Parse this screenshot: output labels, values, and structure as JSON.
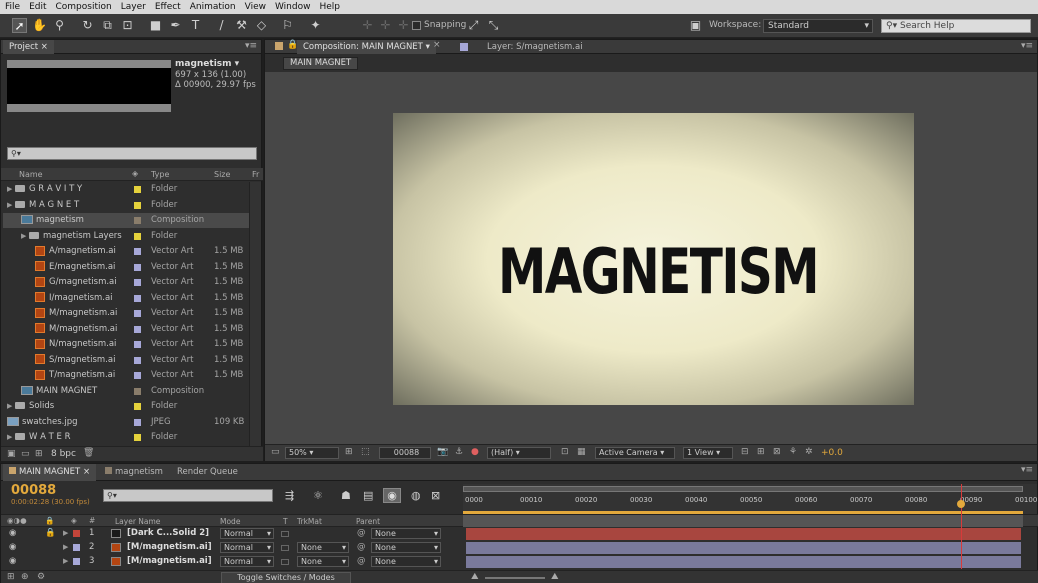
{
  "menu": [
    "File",
    "Edit",
    "Composition",
    "Layer",
    "Effect",
    "Animation",
    "View",
    "Window",
    "Help"
  ],
  "toolbar": {
    "snapping_label": "Snapping",
    "workspace_label": "Workspace:",
    "workspace_value": "Standard",
    "search_placeholder": "Search Help"
  },
  "project": {
    "tab_label": "Project",
    "preview_name": "magnetism ▾",
    "preview_dims": "697 x 136 (1.00)",
    "preview_info": "Δ 00900, 29.97 fps",
    "search_icon": "⚲▾",
    "columns": {
      "name": "Name",
      "type": "Type",
      "size": "Size",
      "fr": "Fr"
    },
    "items": [
      {
        "name": "G R A V I T Y",
        "type": "Folder",
        "size": "",
        "label_color": "#e5d23c",
        "kind": "folder",
        "indent": 0
      },
      {
        "name": "M A G N E T",
        "type": "Folder",
        "size": "",
        "label_color": "#e5d23c",
        "kind": "folder",
        "indent": 0
      },
      {
        "name": "magnetism",
        "type": "Composition",
        "size": "",
        "label_color": "#8a7d6b",
        "kind": "comp",
        "indent": 1
      },
      {
        "name": "magnetism Layers",
        "type": "Folder",
        "size": "",
        "label_color": "#e5d23c",
        "kind": "folder",
        "indent": 1
      },
      {
        "name": "A/magnetism.ai",
        "type": "Vector Art",
        "size": "1.5 MB",
        "label_color": "#a7a8d8",
        "kind": "ai",
        "indent": 2
      },
      {
        "name": "E/magnetism.ai",
        "type": "Vector Art",
        "size": "1.5 MB",
        "label_color": "#a7a8d8",
        "kind": "ai",
        "indent": 2
      },
      {
        "name": "G/magnetism.ai",
        "type": "Vector Art",
        "size": "1.5 MB",
        "label_color": "#a7a8d8",
        "kind": "ai",
        "indent": 2
      },
      {
        "name": "I/magnetism.ai",
        "type": "Vector Art",
        "size": "1.5 MB",
        "label_color": "#a7a8d8",
        "kind": "ai",
        "indent": 2
      },
      {
        "name": "M/magnetism.ai",
        "type": "Vector Art",
        "size": "1.5 MB",
        "label_color": "#a7a8d8",
        "kind": "ai",
        "indent": 2
      },
      {
        "name": "M/magnetism.ai",
        "type": "Vector Art",
        "size": "1.5 MB",
        "label_color": "#a7a8d8",
        "kind": "ai",
        "indent": 2
      },
      {
        "name": "N/magnetism.ai",
        "type": "Vector Art",
        "size": "1.5 MB",
        "label_color": "#a7a8d8",
        "kind": "ai",
        "indent": 2
      },
      {
        "name": "S/magnetism.ai",
        "type": "Vector Art",
        "size": "1.5 MB",
        "label_color": "#a7a8d8",
        "kind": "ai",
        "indent": 2
      },
      {
        "name": "T/magnetism.ai",
        "type": "Vector Art",
        "size": "1.5 MB",
        "label_color": "#a7a8d8",
        "kind": "ai",
        "indent": 2
      },
      {
        "name": "MAIN MAGNET",
        "type": "Composition",
        "size": "",
        "label_color": "#8a7d6b",
        "kind": "comp",
        "indent": 1
      },
      {
        "name": "Solids",
        "type": "Folder",
        "size": "",
        "label_color": "#e5d23c",
        "kind": "folder",
        "indent": 0
      },
      {
        "name": "swatches.jpg",
        "type": "JPEG",
        "size": "109 KB",
        "label_color": "#a7a8d8",
        "kind": "jpg",
        "indent": 0
      },
      {
        "name": "W A T E R",
        "type": "Folder",
        "size": "",
        "label_color": "#e5d23c",
        "kind": "folder",
        "indent": 0
      }
    ],
    "bpc": "8 bpc"
  },
  "composition": {
    "tab_label": "Composition: MAIN MAGNET",
    "layer_tab": "Layer: S/magnetism.ai",
    "subtab": "MAIN MAGNET",
    "canvas_text": "MAGNETISM",
    "zoom": "50%",
    "timecode": "00088",
    "resolution": "(Half)",
    "camera": "Active Camera",
    "view": "1 View",
    "exposure": "+0.0"
  },
  "timeline": {
    "tabs": [
      "MAIN MAGNET",
      "magnetism",
      "Render Queue"
    ],
    "timecode": "00088",
    "timecode_sub": "0:00:02:28 (30.00 fps)",
    "search_icon": "⚲▾",
    "ruler": [
      "0000",
      "00010",
      "00020",
      "00030",
      "00040",
      "00050",
      "00060",
      "00070",
      "00080",
      "00090",
      "00100"
    ],
    "headers": {
      "layer_name": "Layer Name",
      "mode": "Mode",
      "t": "T",
      "trkmat": "TrkMat",
      "parent": "Parent"
    },
    "layers": [
      {
        "num": "1",
        "name": "[Dark C...Solid 2]",
        "mode": "Normal",
        "trkmat": "",
        "parent": "None",
        "label_color": "#c4453a",
        "bar_color": "#a8463f"
      },
      {
        "num": "2",
        "name": "[M/magnetism.ai]",
        "mode": "Normal",
        "trkmat": "None",
        "parent": "None",
        "label_color": "#a7a8d8",
        "bar_color": "#7a7a9c"
      },
      {
        "num": "3",
        "name": "[M/magnetism.ai]",
        "mode": "Normal",
        "trkmat": "None",
        "parent": "None",
        "label_color": "#a7a8d8",
        "bar_color": "#7a7a9c"
      }
    ],
    "toggle_label": "Toggle Switches / Modes",
    "playhead_frame": 88,
    "ruler_max_frame": 100
  }
}
